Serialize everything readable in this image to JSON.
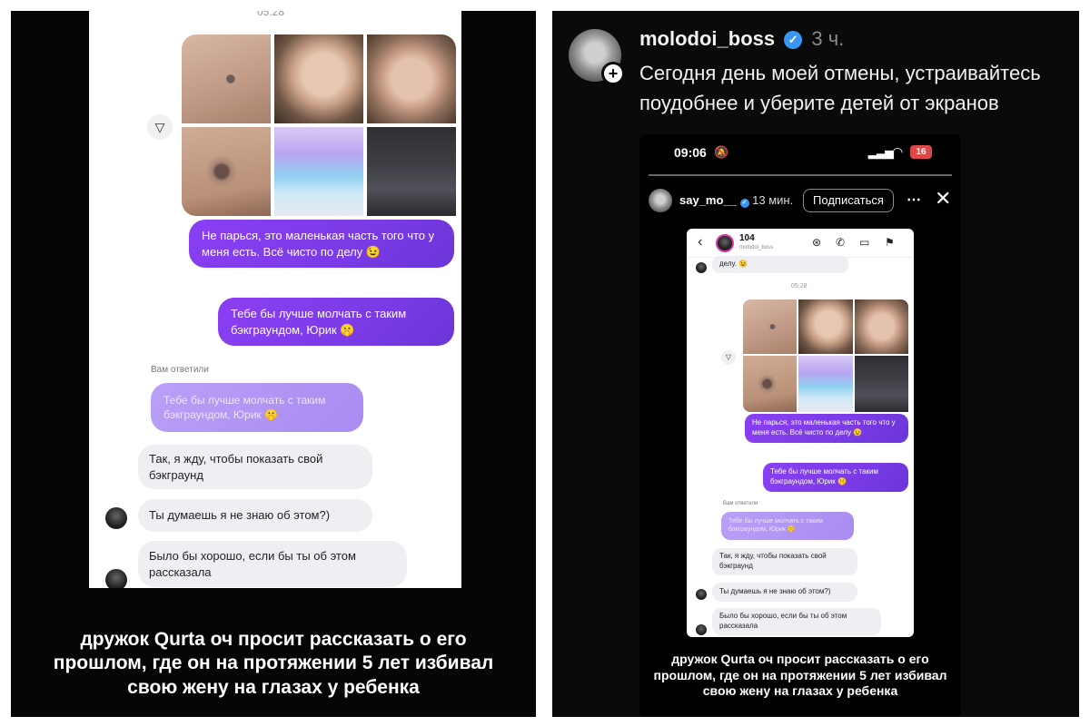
{
  "left": {
    "timestamp": "05:28",
    "sent_msg_1": "Не парься, это маленькая часть того что у меня есть. Всё чисто по делу 😉",
    "sent_msg_2": "Тебе бы лучше молчать с таким бэкграундом, Юрик 🤫",
    "replied_label": "Вам ответили",
    "quoted_msg": "Тебе бы лучше молчать с таким бэкграундом, Юрик 🤫",
    "recv_msg_1": "Так, я жду, чтобы показать свой бэкграунд",
    "recv_msg_2": "Ты думаешь я не знаю об этом?)",
    "recv_msg_3": "Было бы хорошо, если бы ты об этом рассказала",
    "caption": "дружок Qurta оч просит рассказать о его прошлом, где он на протяжении 5 лет избивал свою жену на глазах у ребенка"
  },
  "right": {
    "username": "molodoi_boss",
    "time_ago": "3 ч.",
    "post_text": "Сегодня день моей отмены, устраивайтесь поудобнее и уберите детей от экранов",
    "status_time": "09:06",
    "battery": "16",
    "story_user": "say_mo__",
    "story_time": "13 мин.",
    "follow_label": "Подписаться",
    "dm_name": "104",
    "dm_sub": "molodoi_boss",
    "dm_prev_text": "делу. 😉",
    "timestamp": "05:28",
    "sent_msg_1": "Не парься, это маленькая часть того что у меня есть. Всё чисто по делу 😉",
    "sent_msg_2": "Тебе бы лучше молчать с таким бэкграундом, Юрик 🤫",
    "replied_label": "Вам ответили",
    "quoted_msg": "Тебе бы лучше молчать с таким бэкграундом, Юрик 🤫",
    "recv_msg_1": "Так, я жду, чтобы показать свой бэкграунд",
    "recv_msg_2": "Ты думаешь я не знаю об этом?)",
    "recv_msg_3": "Было бы хорошо, если бы ты об этом рассказала",
    "caption": "дружок Qurta оч просит рассказать о его прошлом, где он на протяжении 5 лет избивал свою жену на глазах у ребенка"
  },
  "colors": {
    "sent_bubble": "#7b3be6",
    "recv_bubble": "#eeeff3",
    "quoted_bubble": "#a98bf2",
    "verified": "#3897f0",
    "battery": "#e04848"
  }
}
